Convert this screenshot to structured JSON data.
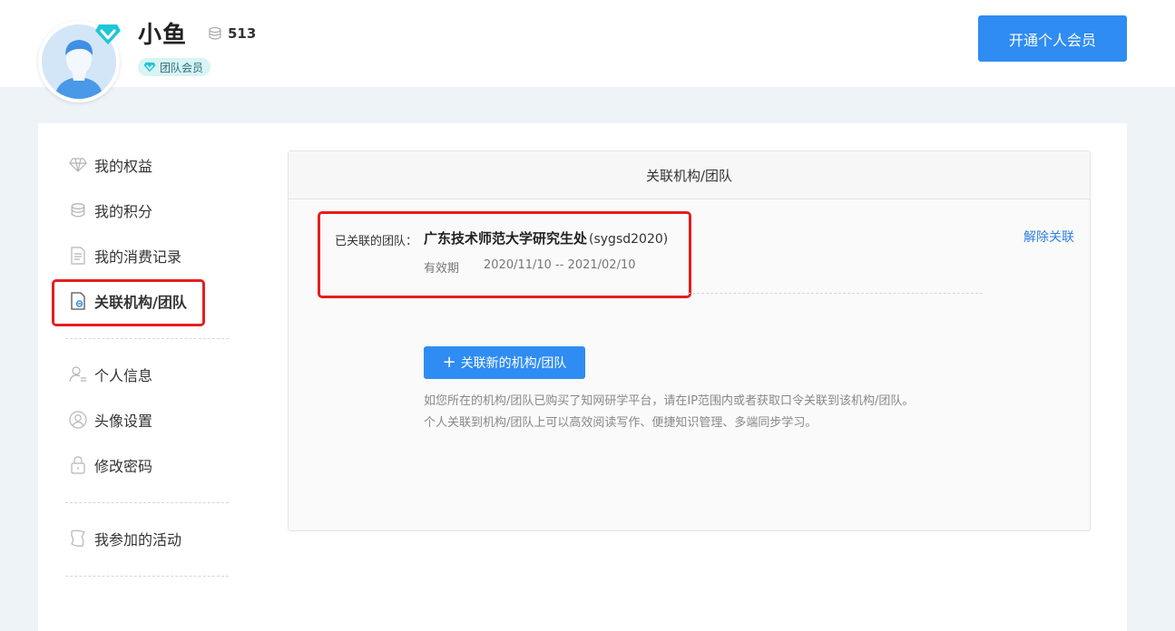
{
  "user": {
    "name": "小鱼",
    "points": "513",
    "team_tag": "团队会员"
  },
  "header": {
    "open_vip_label": "开通个人会员"
  },
  "sidebar": {
    "items": [
      {
        "label": "我的权益",
        "icon": "diamond-icon"
      },
      {
        "label": "我的积分",
        "icon": "coins-icon"
      },
      {
        "label": "我的消费记录",
        "icon": "document-icon"
      },
      {
        "label": "关联机构/团队",
        "icon": "link-document-icon",
        "active": true
      },
      {
        "label": "个人信息",
        "icon": "user-info-icon"
      },
      {
        "label": "头像设置",
        "icon": "avatar-icon"
      },
      {
        "label": "修改密码",
        "icon": "lock-icon"
      },
      {
        "label": "我参加的活动",
        "icon": "activity-icon"
      }
    ]
  },
  "panel": {
    "title": "关联机构/团队",
    "linked_label": "已关联的团队：",
    "org_name": "广东技术师范大学研究生处",
    "org_code": "(sygsd2020)",
    "valid_label": "有效期",
    "valid_range": "2020/11/10 -- 2021/02/10",
    "unlink_label": "解除关联",
    "add_label": "关联新的机构/团队",
    "hint_line1": "如您所在的机构/团队已购买了知网研学平台，请在IP范围内或者获取口令关联到该机构/团队。",
    "hint_line2": "个人关联到机构/团队上可以高效阅读写作、便捷知识管理、多端同步学习。"
  },
  "colors": {
    "primary": "#2f8cf2",
    "highlight": "#e41f1f",
    "link": "#2f7fe0",
    "vip_teal": "#1fc7d4"
  }
}
